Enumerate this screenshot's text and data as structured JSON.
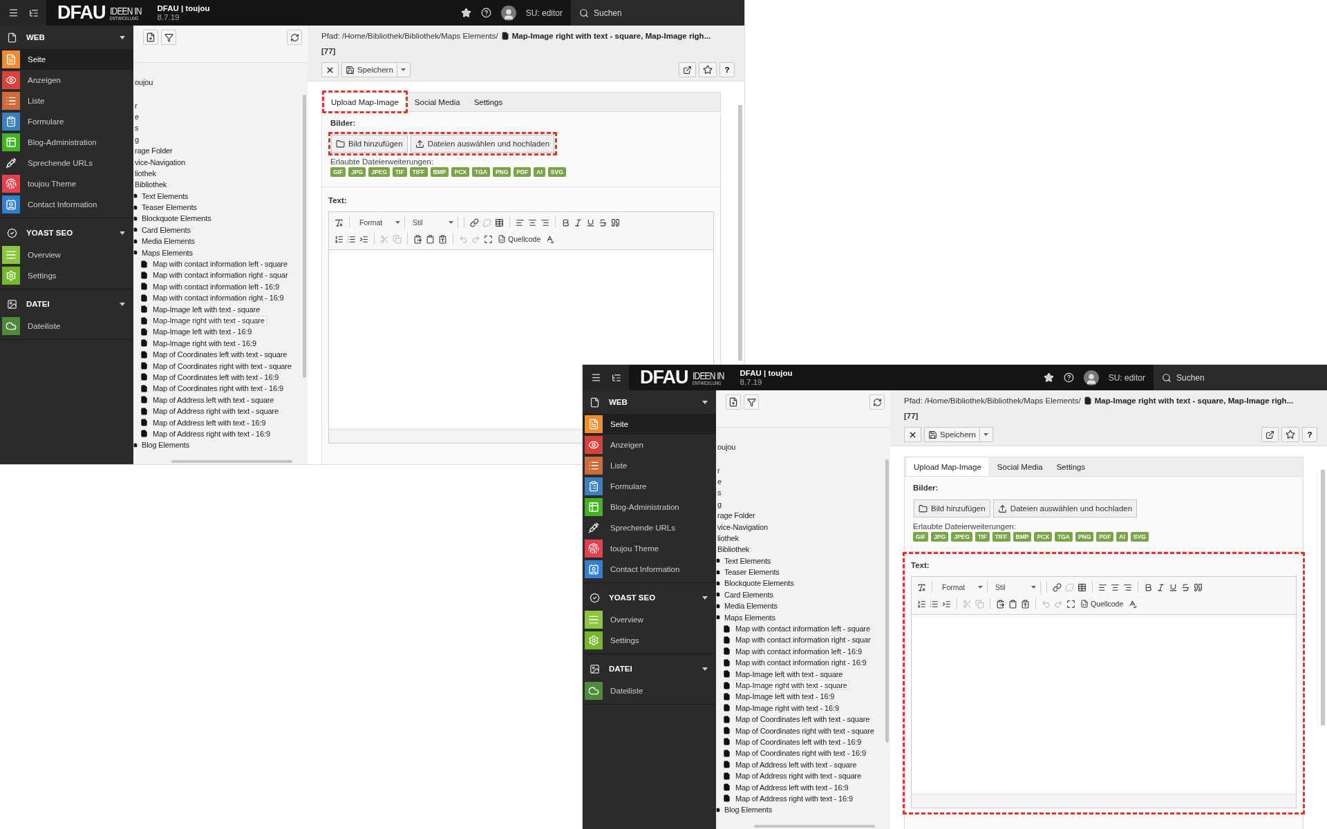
{
  "windows": [
    {
      "highlights": {
        "tab": true,
        "image_buttons": true,
        "text_section": false
      },
      "topbar": {
        "logo_main": "DFAU",
        "logo_line_1": "IDEEN IN",
        "logo_line_2": "ENTWICKLUNG",
        "site_name": "DFAU | toujou",
        "version": "8.7.19",
        "user": "SU: editor",
        "search": "Suchen"
      },
      "sidebar": [
        {
          "title": "WEB",
          "expanded": true,
          "items": [
            {
              "label": "Seite",
              "selected": true,
              "color": "#f08c31"
            },
            {
              "label": "Anzeigen",
              "selected": false,
              "color": "#d9413a"
            },
            {
              "label": "Liste",
              "selected": false,
              "color": "#cd6c3a"
            },
            {
              "label": "Formulare",
              "selected": false,
              "color": "#3a7fbf"
            },
            {
              "label": "Blog-Administration",
              "selected": false,
              "color": "#42b422"
            },
            {
              "label": "Sprechende URLs",
              "selected": false,
              "color": "#2b2b2b"
            },
            {
              "label": "toujou Theme",
              "selected": false,
              "color": "#e6404f"
            },
            {
              "label": "Contact Information",
              "selected": false,
              "color": "#2f80d1"
            }
          ]
        },
        {
          "title": "YOAST SEO",
          "expanded": true,
          "items": [
            {
              "label": "Overview",
              "selected": false,
              "color": "#8cc63f"
            },
            {
              "label": "Settings",
              "selected": false,
              "color": "#76b82a"
            }
          ]
        },
        {
          "title": "DATEI",
          "expanded": true,
          "items": [
            {
              "label": "Dateiliste",
              "selected": false,
              "color": "#4e8c3a"
            }
          ]
        }
      ],
      "tree": [
        {
          "label": "oujou",
          "selected": false,
          "children": [
            {
              "label": "r",
              "selected": false
            },
            {
              "label": "e",
              "selected": false
            },
            {
              "label": "s",
              "selected": false
            },
            {
              "label": "g",
              "selected": false
            },
            {
              "label": "rage Folder",
              "selected": false
            },
            {
              "label": "vice-Navigation",
              "selected": false
            },
            {
              "label": "liothek",
              "selected": false,
              "children": [
                {
                  "label": "Bibliothek",
                  "selected": false,
                  "children": [
                    {
                      "label": "Text Elements",
                      "selected": false
                    },
                    {
                      "label": "Teaser Elements",
                      "selected": false
                    },
                    {
                      "label": "Blockquote Elements",
                      "selected": false
                    },
                    {
                      "label": "Card Elements",
                      "selected": false
                    },
                    {
                      "label": "Media Elements",
                      "selected": false
                    },
                    {
                      "label": "Maps Elements",
                      "selected": false,
                      "children": [
                        {
                          "label": "Map with contact information left - square",
                          "selected": false
                        },
                        {
                          "label": "Map with contact information right - squar",
                          "selected": false
                        },
                        {
                          "label": "Map with contact information left - 16:9",
                          "selected": false
                        },
                        {
                          "label": "Map with contact information right - 16:9",
                          "selected": false
                        },
                        {
                          "label": "Map-Image left with text - square",
                          "selected": false
                        },
                        {
                          "label": "Map-Image right with text - square",
                          "selected": true
                        },
                        {
                          "label": "Map-Image left with text - 16:9",
                          "selected": false
                        },
                        {
                          "label": "Map-Image right with text - 16:9",
                          "selected": false
                        },
                        {
                          "label": "Map of Coordinates left with text - square",
                          "selected": false
                        },
                        {
                          "label": "Map of Coordinates right with text - square",
                          "selected": false
                        },
                        {
                          "label": "Map of Coordinates left with text - 16:9",
                          "selected": false
                        },
                        {
                          "label": "Map of Coordinates right with text - 16:9",
                          "selected": false
                        },
                        {
                          "label": "Map of Address left with text - square",
                          "selected": false
                        },
                        {
                          "label": "Map of Address right with text - square",
                          "selected": false
                        },
                        {
                          "label": "Map of Address left with text - 16:9",
                          "selected": false
                        },
                        {
                          "label": "Map of Address right with text - 16:9",
                          "selected": false
                        }
                      ]
                    },
                    {
                      "label": "Blog Elements",
                      "selected": false
                    }
                  ]
                }
              ]
            }
          ]
        }
      ],
      "path": {
        "prefix": "Pfad: /Home/Bibliothek/Bibliothek/Maps Elements/",
        "title": "Map-Image right with text - square, Map-Image righ...",
        "id": "[77]"
      },
      "toolbar": {
        "save": "Speichern",
        "help": "?"
      },
      "tabs": [
        {
          "label": "Upload Map-Image",
          "selected": true
        },
        {
          "label": "Social Media",
          "selected": false
        },
        {
          "label": "Settings",
          "selected": false
        }
      ],
      "images": {
        "label": "Bilder:",
        "add_button": "Bild hinzufügen",
        "upload_button": "Dateien auswählen und hochladen",
        "extensions_label": "Erlaubte Dateierweiterungen:",
        "extensions": [
          "GIF",
          "JPG",
          "JPEG",
          "TIF",
          "TIFF",
          "BMP",
          "PCX",
          "TGA",
          "PNG",
          "PDF",
          "AI",
          "SVG"
        ]
      },
      "text": {
        "label": "Text:",
        "rows": [
          [
            {
              "kind": "icon",
              "disabled": false
            },
            {
              "kind": "dropdown",
              "label": "Format"
            },
            {
              "kind": "dropdown",
              "label": "Stil"
            },
            {
              "kind": "icon",
              "disabled": false
            },
            {
              "kind": "icon",
              "disabled": true
            },
            {
              "kind": "icon",
              "disabled": false
            },
            {
              "kind": "icon",
              "disabled": false
            },
            {
              "kind": "icon",
              "disabled": false
            },
            {
              "kind": "icon",
              "disabled": false
            },
            {
              "kind": "icon",
              "disabled": false
            },
            {
              "kind": "icon",
              "disabled": false
            },
            {
              "kind": "icon",
              "disabled": false
            },
            {
              "kind": "icon",
              "disabled": false
            },
            {
              "kind": "icon",
              "disabled": false
            }
          ],
          [
            {
              "kind": "icon",
              "disabled": false
            },
            {
              "kind": "icon",
              "disabled": false
            },
            {
              "kind": "icon",
              "disabled": false
            },
            {
              "kind": "icon",
              "disabled": true
            },
            {
              "kind": "icon",
              "disabled": true
            },
            {
              "kind": "icon",
              "disabled": false
            },
            {
              "kind": "icon",
              "disabled": false
            },
            {
              "kind": "icon",
              "disabled": false
            },
            {
              "kind": "icon",
              "disabled": true
            },
            {
              "kind": "icon",
              "disabled": true
            },
            {
              "kind": "icon",
              "disabled": false
            },
            {
              "kind": "source",
              "label": "Quellcode"
            },
            {
              "kind": "icon",
              "disabled": false
            }
          ]
        ]
      }
    },
    {
      "highlights": {
        "tab": false,
        "image_buttons": false,
        "text_section": true
      },
      "topbar": {
        "logo_main": "DFAU",
        "logo_line_1": "IDEEN IN",
        "logo_line_2": "ENTWICKLUNG",
        "site_name": "DFAU | toujou",
        "version": "8.7.19",
        "user": "SU: editor",
        "search": "Suchen"
      },
      "sidebar": [
        {
          "title": "WEB",
          "expanded": true,
          "items": [
            {
              "label": "Seite",
              "selected": true,
              "color": "#f08c31"
            },
            {
              "label": "Anzeigen",
              "selected": false,
              "color": "#d9413a"
            },
            {
              "label": "Liste",
              "selected": false,
              "color": "#cd6c3a"
            },
            {
              "label": "Formulare",
              "selected": false,
              "color": "#3a7fbf"
            },
            {
              "label": "Blog-Administration",
              "selected": false,
              "color": "#42b422"
            },
            {
              "label": "Sprechende URLs",
              "selected": false,
              "color": "#2b2b2b"
            },
            {
              "label": "toujou Theme",
              "selected": false,
              "color": "#e6404f"
            },
            {
              "label": "Contact Information",
              "selected": false,
              "color": "#2f80d1"
            }
          ]
        },
        {
          "title": "YOAST SEO",
          "expanded": true,
          "items": [
            {
              "label": "Overview",
              "selected": false,
              "color": "#8cc63f"
            },
            {
              "label": "Settings",
              "selected": false,
              "color": "#76b82a"
            }
          ]
        },
        {
          "title": "DATEI",
          "expanded": true,
          "items": [
            {
              "label": "Dateiliste",
              "selected": false,
              "color": "#4e8c3a"
            }
          ]
        }
      ],
      "tree": [
        {
          "label": "oujou",
          "selected": false,
          "children": [
            {
              "label": "r",
              "selected": false
            },
            {
              "label": "e",
              "selected": false
            },
            {
              "label": "s",
              "selected": false
            },
            {
              "label": "g",
              "selected": false
            },
            {
              "label": "rage Folder",
              "selected": false
            },
            {
              "label": "vice-Navigation",
              "selected": false
            },
            {
              "label": "liothek",
              "selected": false,
              "children": [
                {
                  "label": "Bibliothek",
                  "selected": false,
                  "children": [
                    {
                      "label": "Text Elements",
                      "selected": false
                    },
                    {
                      "label": "Teaser Elements",
                      "selected": false
                    },
                    {
                      "label": "Blockquote Elements",
                      "selected": false
                    },
                    {
                      "label": "Card Elements",
                      "selected": false
                    },
                    {
                      "label": "Media Elements",
                      "selected": false
                    },
                    {
                      "label": "Maps Elements",
                      "selected": false,
                      "children": [
                        {
                          "label": "Map with contact information left - square",
                          "selected": false
                        },
                        {
                          "label": "Map with contact information right - squar",
                          "selected": false
                        },
                        {
                          "label": "Map with contact information left - 16:9",
                          "selected": false
                        },
                        {
                          "label": "Map with contact information right - 16:9",
                          "selected": false
                        },
                        {
                          "label": "Map-Image left with text - square",
                          "selected": false
                        },
                        {
                          "label": "Map-Image right with text - square",
                          "selected": true
                        },
                        {
                          "label": "Map-Image left with text - 16:9",
                          "selected": false
                        },
                        {
                          "label": "Map-Image right with text - 16:9",
                          "selected": false
                        },
                        {
                          "label": "Map of Coordinates left with text - square",
                          "selected": false
                        },
                        {
                          "label": "Map of Coordinates right with text - square",
                          "selected": false
                        },
                        {
                          "label": "Map of Coordinates left with text - 16:9",
                          "selected": false
                        },
                        {
                          "label": "Map of Coordinates right with text - 16:9",
                          "selected": false
                        },
                        {
                          "label": "Map of Address left with text - square",
                          "selected": false
                        },
                        {
                          "label": "Map of Address right with text - square",
                          "selected": false
                        },
                        {
                          "label": "Map of Address left with text - 16:9",
                          "selected": false
                        },
                        {
                          "label": "Map of Address right with text - 16:9",
                          "selected": false
                        }
                      ]
                    },
                    {
                      "label": "Blog Elements",
                      "selected": false
                    }
                  ]
                }
              ]
            }
          ]
        }
      ],
      "path": {
        "prefix": "Pfad: /Home/Bibliothek/Bibliothek/Maps Elements/",
        "title": "Map-Image right with text - square, Map-Image righ...",
        "id": "[77]"
      },
      "toolbar": {
        "save": "Speichern",
        "help": "?"
      },
      "tabs": [
        {
          "label": "Upload Map-Image",
          "selected": true
        },
        {
          "label": "Social Media",
          "selected": false
        },
        {
          "label": "Settings",
          "selected": false
        }
      ],
      "images": {
        "label": "Bilder:",
        "add_button": "Bild hinzufügen",
        "upload_button": "Dateien auswählen und hochladen",
        "extensions_label": "Erlaubte Dateierweiterungen:",
        "extensions": [
          "GIF",
          "JPG",
          "JPEG",
          "TIF",
          "TIFF",
          "BMP",
          "PCX",
          "TGA",
          "PNG",
          "PDF",
          "AI",
          "SVG"
        ]
      },
      "text": {
        "label": "Text:",
        "rows": [
          [
            {
              "kind": "icon",
              "disabled": false
            },
            {
              "kind": "dropdown",
              "label": "Format"
            },
            {
              "kind": "dropdown",
              "label": "Stil"
            },
            {
              "kind": "icon",
              "disabled": false
            },
            {
              "kind": "icon",
              "disabled": true
            },
            {
              "kind": "icon",
              "disabled": false
            },
            {
              "kind": "icon",
              "disabled": false
            },
            {
              "kind": "icon",
              "disabled": false
            },
            {
              "kind": "icon",
              "disabled": false
            },
            {
              "kind": "icon",
              "disabled": false
            },
            {
              "kind": "icon",
              "disabled": false
            },
            {
              "kind": "icon",
              "disabled": false
            },
            {
              "kind": "icon",
              "disabled": false
            },
            {
              "kind": "icon",
              "disabled": false
            }
          ],
          [
            {
              "kind": "icon",
              "disabled": false
            },
            {
              "kind": "icon",
              "disabled": false
            },
            {
              "kind": "icon",
              "disabled": false
            },
            {
              "kind": "icon",
              "disabled": true
            },
            {
              "kind": "icon",
              "disabled": true
            },
            {
              "kind": "icon",
              "disabled": false
            },
            {
              "kind": "icon",
              "disabled": false
            },
            {
              "kind": "icon",
              "disabled": false
            },
            {
              "kind": "icon",
              "disabled": true
            },
            {
              "kind": "icon",
              "disabled": true
            },
            {
              "kind": "icon",
              "disabled": false
            },
            {
              "kind": "source",
              "label": "Quellcode"
            },
            {
              "kind": "icon",
              "disabled": false
            }
          ]
        ]
      }
    }
  ]
}
